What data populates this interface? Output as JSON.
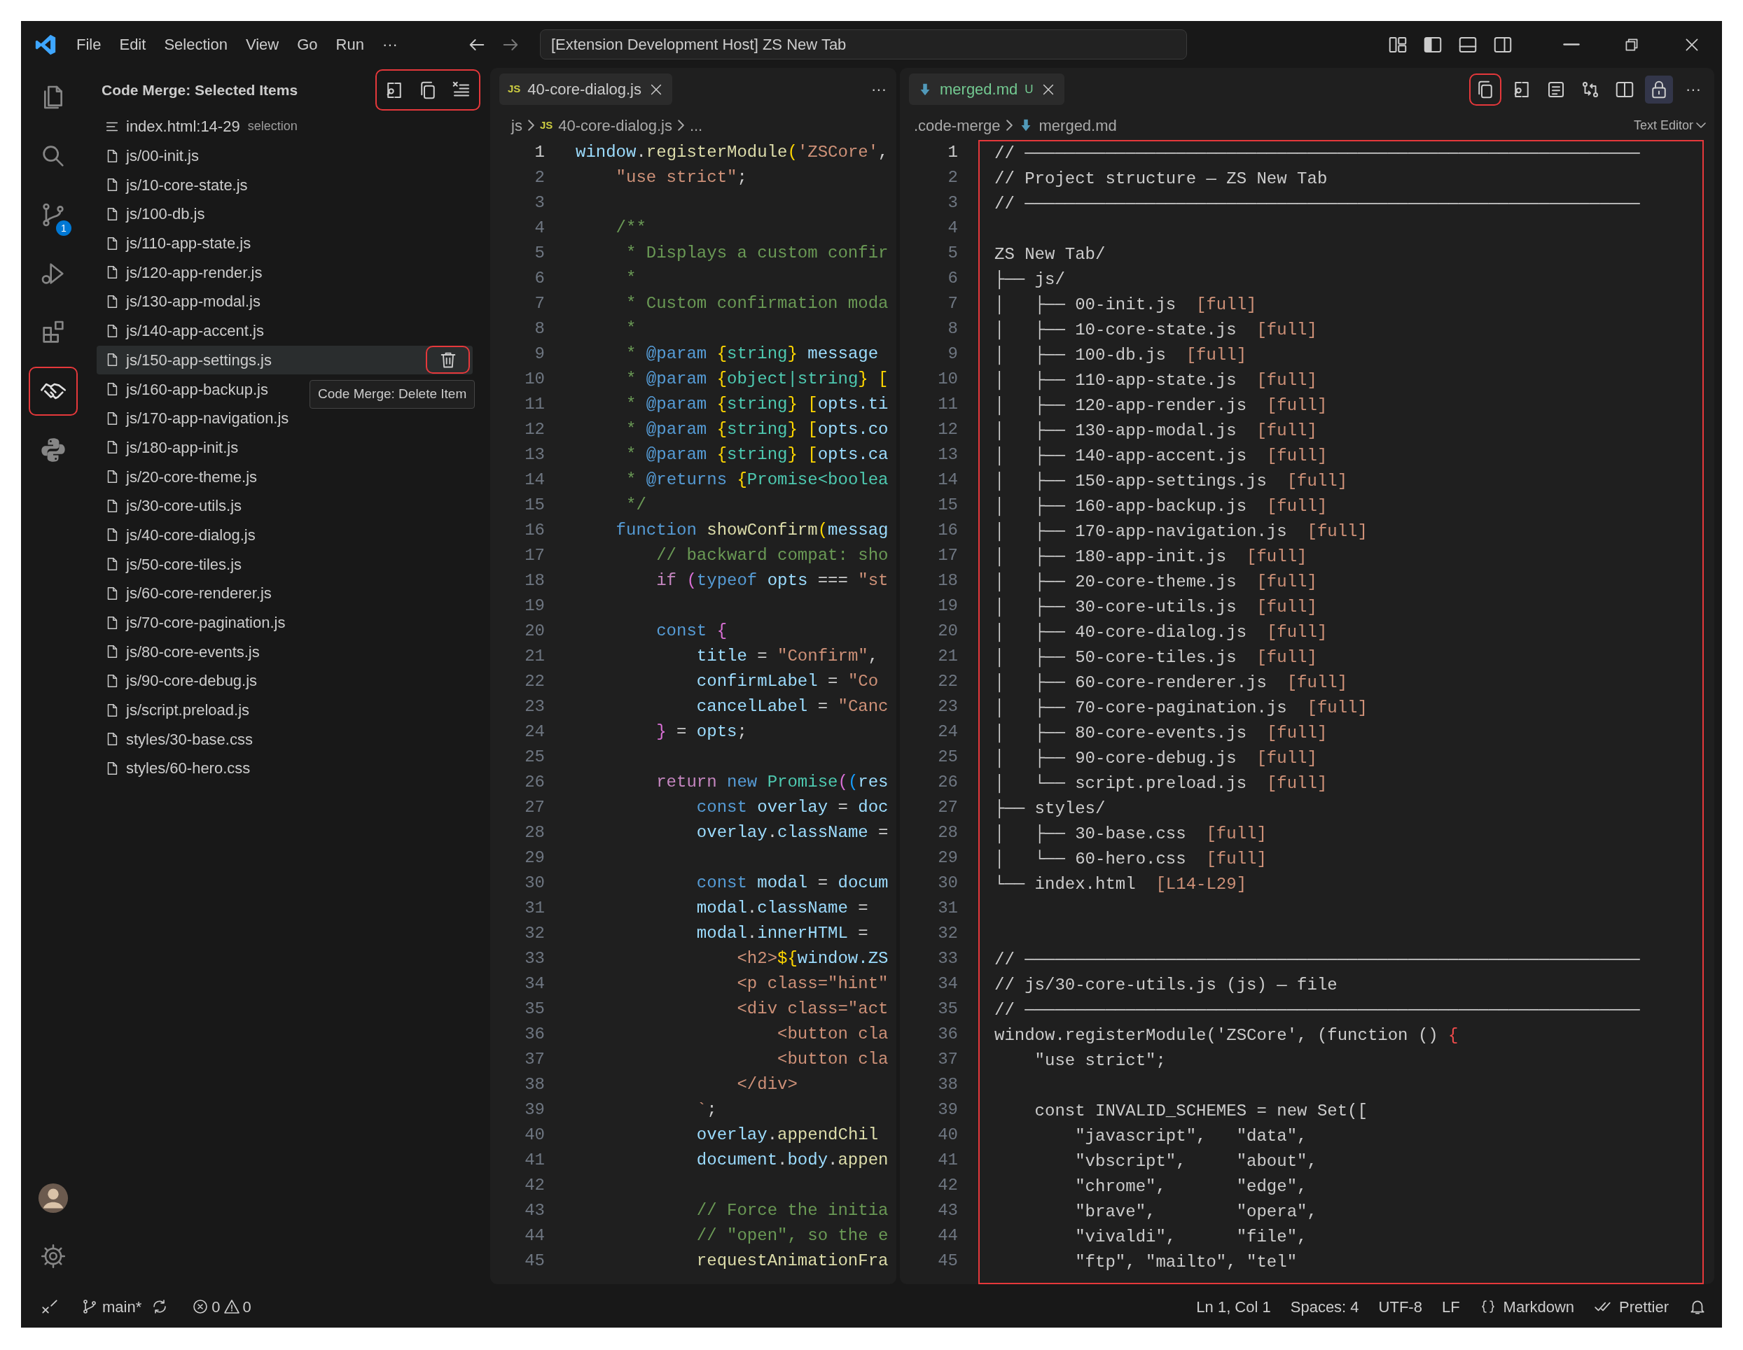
{
  "title_bar": {
    "menus": [
      "File",
      "Edit",
      "Selection",
      "View",
      "Go",
      "Run",
      "···"
    ],
    "command_center": "[Extension Development Host] ZS New Tab"
  },
  "activity_bar": {
    "items": [
      {
        "kind": "explorer",
        "selected": false
      },
      {
        "kind": "search",
        "selected": false
      },
      {
        "kind": "scm",
        "selected": false,
        "badge": "1"
      },
      {
        "kind": "debug",
        "selected": false
      },
      {
        "kind": "extensions",
        "selected": false
      },
      {
        "kind": "handshake",
        "selected": true,
        "red_frame": true
      },
      {
        "kind": "python",
        "selected": false
      }
    ]
  },
  "sidebar": {
    "title": "Code Merge: Selected Items",
    "toolbar_red_frame": true,
    "toolbar": [
      {
        "kind": "compare"
      },
      {
        "kind": "copy"
      },
      {
        "kind": "clear"
      }
    ],
    "items": [
      {
        "kind": "selection",
        "label": "index.html:14-29",
        "description": "selection",
        "hovered": false
      },
      {
        "kind": "file",
        "label": "js/00-init.js",
        "hovered": false
      },
      {
        "kind": "file",
        "label": "js/10-core-state.js",
        "hovered": false
      },
      {
        "kind": "file",
        "label": "js/100-db.js",
        "hovered": false
      },
      {
        "kind": "file",
        "label": "js/110-app-state.js",
        "hovered": false
      },
      {
        "kind": "file",
        "label": "js/120-app-render.js",
        "hovered": false
      },
      {
        "kind": "file",
        "label": "js/130-app-modal.js",
        "hovered": false
      },
      {
        "kind": "file",
        "label": "js/140-app-accent.js",
        "hovered": false
      },
      {
        "kind": "file",
        "label": "js/150-app-settings.js",
        "hovered": true
      },
      {
        "kind": "file",
        "label": "js/160-app-backup.js",
        "hovered": false
      },
      {
        "kind": "file",
        "label": "js/170-app-navigation.js",
        "hovered": false
      },
      {
        "kind": "file",
        "label": "js/180-app-init.js",
        "hovered": false
      },
      {
        "kind": "file",
        "label": "js/20-core-theme.js",
        "hovered": false
      },
      {
        "kind": "file",
        "label": "js/30-core-utils.js",
        "hovered": false
      },
      {
        "kind": "file",
        "label": "js/40-core-dialog.js",
        "hovered": false
      },
      {
        "kind": "file",
        "label": "js/50-core-tiles.js",
        "hovered": false
      },
      {
        "kind": "file",
        "label": "js/60-core-renderer.js",
        "hovered": false
      },
      {
        "kind": "file",
        "label": "js/70-core-pagination.js",
        "hovered": false
      },
      {
        "kind": "file",
        "label": "js/80-core-events.js",
        "hovered": false
      },
      {
        "kind": "file",
        "label": "js/90-core-debug.js",
        "hovered": false
      },
      {
        "kind": "file",
        "label": "js/script.preload.js",
        "hovered": false
      },
      {
        "kind": "file",
        "label": "styles/30-base.css",
        "hovered": false
      },
      {
        "kind": "file",
        "label": "styles/60-hero.css",
        "hovered": false
      }
    ],
    "hover_action": {
      "red_frame": true
    },
    "tooltip": "Code Merge: Delete Item"
  },
  "editors": [
    {
      "tabs": [
        {
          "badge": "JS",
          "label": "40-core-dialog.js",
          "selected": true
        }
      ],
      "more": "···",
      "breadcrumb": [
        {
          "label": "js"
        },
        {
          "label": "40-core-dialog.js",
          "badge": "JS"
        },
        {
          "label": "..."
        }
      ],
      "lines": [
        {
          "n": "1",
          "current": true,
          "tokens": [
            {
              "text": "window",
              "kind": "variable"
            },
            {
              "text": ".",
              "kind": "plain"
            },
            {
              "text": "registerModule",
              "kind": "function"
            },
            {
              "text": "(",
              "kind": "bracket1"
            },
            {
              "text": "'ZSCore'",
              "kind": "string"
            },
            {
              "text": ",",
              "kind": "plain"
            }
          ]
        },
        {
          "n": "2",
          "current": false,
          "tokens": [
            {
              "text": "    \"use strict\"",
              "kind": "string"
            },
            {
              "text": ";",
              "kind": "plain"
            }
          ]
        },
        {
          "n": "3",
          "current": false
        },
        {
          "n": "4",
          "current": false,
          "tokens": [
            {
              "text": "    /**",
              "kind": "comment"
            }
          ]
        },
        {
          "n": "5",
          "current": false,
          "tokens": [
            {
              "text": "     * Displays a custom confir",
              "kind": "comment"
            }
          ]
        },
        {
          "n": "6",
          "current": false,
          "tokens": [
            {
              "text": "     *",
              "kind": "comment"
            }
          ]
        },
        {
          "n": "7",
          "current": false,
          "tokens": [
            {
              "text": "     * Custom confirmation moda",
              "kind": "comment"
            }
          ]
        },
        {
          "n": "8",
          "current": false,
          "tokens": [
            {
              "text": "     *",
              "kind": "comment"
            }
          ]
        },
        {
          "n": "9",
          "current": false,
          "tokens": [
            {
              "text": "     *",
              "kind": "comment"
            },
            {
              "text": " @param ",
              "kind": "keyword"
            },
            {
              "text": "{",
              "kind": "bracket1"
            },
            {
              "text": "string",
              "kind": "type"
            },
            {
              "text": "}",
              "kind": "bracket1"
            },
            {
              "text": " message",
              "kind": "variable"
            }
          ]
        },
        {
          "n": "10",
          "current": false,
          "tokens": [
            {
              "text": "     *",
              "kind": "comment"
            },
            {
              "text": " @param ",
              "kind": "keyword"
            },
            {
              "text": "{",
              "kind": "bracket1"
            },
            {
              "text": "object|string",
              "kind": "type"
            },
            {
              "text": "}",
              "kind": "bracket1"
            },
            {
              "text": " [",
              "kind": "bracket1"
            }
          ]
        },
        {
          "n": "11",
          "current": false,
          "tokens": [
            {
              "text": "     *",
              "kind": "comment"
            },
            {
              "text": " @param ",
              "kind": "keyword"
            },
            {
              "text": "{",
              "kind": "bracket1"
            },
            {
              "text": "string",
              "kind": "type"
            },
            {
              "text": "}",
              "kind": "bracket1"
            },
            {
              "text": " [",
              "kind": "bracket1"
            },
            {
              "text": "opts.ti",
              "kind": "variable"
            }
          ]
        },
        {
          "n": "12",
          "current": false,
          "tokens": [
            {
              "text": "     *",
              "kind": "comment"
            },
            {
              "text": " @param ",
              "kind": "keyword"
            },
            {
              "text": "{",
              "kind": "bracket1"
            },
            {
              "text": "string",
              "kind": "type"
            },
            {
              "text": "}",
              "kind": "bracket1"
            },
            {
              "text": " [",
              "kind": "bracket1"
            },
            {
              "text": "opts.co",
              "kind": "variable"
            }
          ]
        },
        {
          "n": "13",
          "current": false,
          "tokens": [
            {
              "text": "     *",
              "kind": "comment"
            },
            {
              "text": " @param ",
              "kind": "keyword"
            },
            {
              "text": "{",
              "kind": "bracket1"
            },
            {
              "text": "string",
              "kind": "type"
            },
            {
              "text": "}",
              "kind": "bracket1"
            },
            {
              "text": " [",
              "kind": "bracket1"
            },
            {
              "text": "opts.ca",
              "kind": "variable"
            }
          ]
        },
        {
          "n": "14",
          "current": false,
          "tokens": [
            {
              "text": "     *",
              "kind": "comment"
            },
            {
              "text": " @returns ",
              "kind": "keyword"
            },
            {
              "text": "{",
              "kind": "bracket1"
            },
            {
              "text": "Promise<boolea",
              "kind": "type"
            }
          ]
        },
        {
          "n": "15",
          "current": false,
          "tokens": [
            {
              "text": "     */",
              "kind": "comment"
            }
          ]
        },
        {
          "n": "16",
          "current": false,
          "tokens": [
            {
              "text": "    function ",
              "kind": "keyword"
            },
            {
              "text": "showConfirm",
              "kind": "function"
            },
            {
              "text": "(",
              "kind": "bracket1"
            },
            {
              "text": "messag",
              "kind": "variable"
            }
          ]
        },
        {
          "n": "17",
          "current": false,
          "tokens": [
            {
              "text": "        // backward compat: sho",
              "kind": "comment"
            }
          ]
        },
        {
          "n": "18",
          "current": false,
          "tokens": [
            {
              "text": "        if ",
              "kind": "control"
            },
            {
              "text": "(",
              "kind": "bracket2"
            },
            {
              "text": "typeof",
              "kind": "keyword"
            },
            {
              "text": " opts",
              "kind": "variable"
            },
            {
              "text": " === ",
              "kind": "plain"
            },
            {
              "text": "\"st",
              "kind": "string"
            }
          ]
        },
        {
          "n": "19",
          "current": false
        },
        {
          "n": "20",
          "current": false,
          "tokens": [
            {
              "text": "        const ",
              "kind": "keyword"
            },
            {
              "text": "{",
              "kind": "bracket2"
            }
          ]
        },
        {
          "n": "21",
          "current": false,
          "tokens": [
            {
              "text": "            title",
              "kind": "variable"
            },
            {
              "text": " = ",
              "kind": "plain"
            },
            {
              "text": "\"Confirm\"",
              "kind": "string"
            },
            {
              "text": ",",
              "kind": "plain"
            }
          ]
        },
        {
          "n": "22",
          "current": false,
          "tokens": [
            {
              "text": "            confirmLabel",
              "kind": "variable"
            },
            {
              "text": " = ",
              "kind": "plain"
            },
            {
              "text": "\"Co",
              "kind": "string"
            }
          ]
        },
        {
          "n": "23",
          "current": false,
          "tokens": [
            {
              "text": "            cancelLabel",
              "kind": "variable"
            },
            {
              "text": " = ",
              "kind": "plain"
            },
            {
              "text": "\"Canc",
              "kind": "string"
            }
          ]
        },
        {
          "n": "24",
          "current": false,
          "tokens": [
            {
              "text": "        }",
              "kind": "bracket2"
            },
            {
              "text": " = ",
              "kind": "plain"
            },
            {
              "text": "opts",
              "kind": "variable"
            },
            {
              "text": ";",
              "kind": "plain"
            }
          ]
        },
        {
          "n": "25",
          "current": false
        },
        {
          "n": "26",
          "current": false,
          "tokens": [
            {
              "text": "        return",
              "kind": "control"
            },
            {
              "text": " new",
              "kind": "keyword"
            },
            {
              "text": " Promise",
              "kind": "type"
            },
            {
              "text": "(",
              "kind": "bracket2"
            },
            {
              "text": "(",
              "kind": "bracket3"
            },
            {
              "text": "res",
              "kind": "variable"
            }
          ]
        },
        {
          "n": "27",
          "current": false,
          "tokens": [
            {
              "text": "            const",
              "kind": "keyword"
            },
            {
              "text": " overlay",
              "kind": "variable"
            },
            {
              "text": " = ",
              "kind": "plain"
            },
            {
              "text": "doc",
              "kind": "variable"
            }
          ]
        },
        {
          "n": "28",
          "current": false,
          "tokens": [
            {
              "text": "            overlay",
              "kind": "variable"
            },
            {
              "text": ".",
              "kind": "plain"
            },
            {
              "text": "className",
              "kind": "variable"
            },
            {
              "text": " =",
              "kind": "plain"
            }
          ]
        },
        {
          "n": "29",
          "current": false
        },
        {
          "n": "30",
          "current": false,
          "tokens": [
            {
              "text": "            const",
              "kind": "keyword"
            },
            {
              "text": " modal",
              "kind": "variable"
            },
            {
              "text": " = ",
              "kind": "plain"
            },
            {
              "text": "docum",
              "kind": "variable"
            }
          ]
        },
        {
          "n": "31",
          "current": false,
          "tokens": [
            {
              "text": "            modal",
              "kind": "variable"
            },
            {
              "text": ".",
              "kind": "plain"
            },
            {
              "text": "className",
              "kind": "variable"
            },
            {
              "text": " =",
              "kind": "plain"
            }
          ]
        },
        {
          "n": "32",
          "current": false,
          "tokens": [
            {
              "text": "            modal",
              "kind": "variable"
            },
            {
              "text": ".",
              "kind": "plain"
            },
            {
              "text": "innerHTML",
              "kind": "variable"
            },
            {
              "text": " =",
              "kind": "plain"
            }
          ]
        },
        {
          "n": "33",
          "current": false,
          "tokens": [
            {
              "text": "                <h2>",
              "kind": "string"
            },
            {
              "text": "${",
              "kind": "bracket1"
            },
            {
              "text": "window.ZS",
              "kind": "variable"
            }
          ]
        },
        {
          "n": "34",
          "current": false,
          "tokens": [
            {
              "text": "                <p class=\"hint\"",
              "kind": "string"
            }
          ]
        },
        {
          "n": "35",
          "current": false,
          "tokens": [
            {
              "text": "                <div class=\"act",
              "kind": "string"
            }
          ]
        },
        {
          "n": "36",
          "current": false,
          "tokens": [
            {
              "text": "                    <button cla",
              "kind": "string"
            }
          ]
        },
        {
          "n": "37",
          "current": false,
          "tokens": [
            {
              "text": "                    <button cla",
              "kind": "string"
            }
          ]
        },
        {
          "n": "38",
          "current": false,
          "tokens": [
            {
              "text": "                </div>",
              "kind": "string"
            }
          ]
        },
        {
          "n": "39",
          "current": false,
          "tokens": [
            {
              "text": "            `",
              "kind": "string"
            },
            {
              "text": ";",
              "kind": "plain"
            }
          ]
        },
        {
          "n": "40",
          "current": false,
          "tokens": [
            {
              "text": "            overlay",
              "kind": "variable"
            },
            {
              "text": ".",
              "kind": "plain"
            },
            {
              "text": "appendChil",
              "kind": "function"
            }
          ]
        },
        {
          "n": "41",
          "current": false,
          "tokens": [
            {
              "text": "            document",
              "kind": "variable"
            },
            {
              "text": ".",
              "kind": "plain"
            },
            {
              "text": "body",
              "kind": "variable"
            },
            {
              "text": ".",
              "kind": "plain"
            },
            {
              "text": "appen",
              "kind": "function"
            }
          ]
        },
        {
          "n": "42",
          "current": false
        },
        {
          "n": "43",
          "current": false,
          "tokens": [
            {
              "text": "            // Force the initia",
              "kind": "comment"
            }
          ]
        },
        {
          "n": "44",
          "current": false,
          "tokens": [
            {
              "text": "            // \"open\", so the e",
              "kind": "comment"
            }
          ]
        },
        {
          "n": "45",
          "current": false,
          "tokens": [
            {
              "text": "            requestAnimationFra",
              "kind": "function"
            }
          ]
        }
      ]
    },
    {
      "tabs": [
        {
          "kind": "markdown",
          "label": "merged.md",
          "status": "U",
          "selected": true
        }
      ],
      "toolbar": [
        {
          "kind": "copy",
          "red_frame": true
        },
        {
          "kind": "compare"
        },
        {
          "kind": "preview"
        },
        {
          "kind": "gitcompare"
        },
        {
          "kind": "split"
        },
        {
          "kind": "lock",
          "on": true
        },
        {
          "kind": "more",
          "text": "···"
        }
      ],
      "breadcrumb": [
        {
          "label": ".code-merge"
        },
        {
          "label": "merged.md",
          "kind": "markdown"
        }
      ],
      "view_mode": "Text Editor",
      "red_frame": true,
      "lines": [
        {
          "n": "1",
          "current": true,
          "tokens": [
            {
              "text": "// ─────────────────────────────────────────────────────────────",
              "kind": "plain"
            }
          ]
        },
        {
          "n": "2",
          "current": false,
          "tokens": [
            {
              "text": "// Project structure — ZS New Tab",
              "kind": "plain"
            }
          ]
        },
        {
          "n": "3",
          "current": false,
          "tokens": [
            {
              "text": "// ─────────────────────────────────────────────────────────────",
              "kind": "plain"
            }
          ]
        },
        {
          "n": "4",
          "current": false
        },
        {
          "n": "5",
          "current": false,
          "tokens": [
            {
              "text": "ZS New Tab/",
              "kind": "plain"
            }
          ]
        },
        {
          "n": "6",
          "current": false,
          "tokens": [
            {
              "text": "├── js/",
              "kind": "plain"
            }
          ]
        },
        {
          "n": "7",
          "current": false,
          "tokens": [
            {
              "text": "│   ├── 00-init.js  ",
              "kind": "plain"
            },
            {
              "text": "[full]",
              "kind": "tag"
            }
          ]
        },
        {
          "n": "8",
          "current": false,
          "tokens": [
            {
              "text": "│   ├── 10-core-state.js  ",
              "kind": "plain"
            },
            {
              "text": "[full]",
              "kind": "tag"
            }
          ]
        },
        {
          "n": "9",
          "current": false,
          "tokens": [
            {
              "text": "│   ├── 100-db.js  ",
              "kind": "plain"
            },
            {
              "text": "[full]",
              "kind": "tag"
            }
          ]
        },
        {
          "n": "10",
          "current": false,
          "tokens": [
            {
              "text": "│   ├── 110-app-state.js  ",
              "kind": "plain"
            },
            {
              "text": "[full]",
              "kind": "tag"
            }
          ]
        },
        {
          "n": "11",
          "current": false,
          "tokens": [
            {
              "text": "│   ├── 120-app-render.js  ",
              "kind": "plain"
            },
            {
              "text": "[full]",
              "kind": "tag"
            }
          ]
        },
        {
          "n": "12",
          "current": false,
          "tokens": [
            {
              "text": "│   ├── 130-app-modal.js  ",
              "kind": "plain"
            },
            {
              "text": "[full]",
              "kind": "tag"
            }
          ]
        },
        {
          "n": "13",
          "current": false,
          "tokens": [
            {
              "text": "│   ├── 140-app-accent.js  ",
              "kind": "plain"
            },
            {
              "text": "[full]",
              "kind": "tag"
            }
          ]
        },
        {
          "n": "14",
          "current": false,
          "tokens": [
            {
              "text": "│   ├── 150-app-settings.js  ",
              "kind": "plain"
            },
            {
              "text": "[full]",
              "kind": "tag"
            }
          ]
        },
        {
          "n": "15",
          "current": false,
          "tokens": [
            {
              "text": "│   ├── 160-app-backup.js  ",
              "kind": "plain"
            },
            {
              "text": "[full]",
              "kind": "tag"
            }
          ]
        },
        {
          "n": "16",
          "current": false,
          "tokens": [
            {
              "text": "│   ├── 170-app-navigation.js  ",
              "kind": "plain"
            },
            {
              "text": "[full]",
              "kind": "tag"
            }
          ]
        },
        {
          "n": "17",
          "current": false,
          "tokens": [
            {
              "text": "│   ├── 180-app-init.js  ",
              "kind": "plain"
            },
            {
              "text": "[full]",
              "kind": "tag"
            }
          ]
        },
        {
          "n": "18",
          "current": false,
          "tokens": [
            {
              "text": "│   ├── 20-core-theme.js  ",
              "kind": "plain"
            },
            {
              "text": "[full]",
              "kind": "tag"
            }
          ]
        },
        {
          "n": "19",
          "current": false,
          "tokens": [
            {
              "text": "│   ├── 30-core-utils.js  ",
              "kind": "plain"
            },
            {
              "text": "[full]",
              "kind": "tag"
            }
          ]
        },
        {
          "n": "20",
          "current": false,
          "tokens": [
            {
              "text": "│   ├── 40-core-dialog.js  ",
              "kind": "plain"
            },
            {
              "text": "[full]",
              "kind": "tag"
            }
          ]
        },
        {
          "n": "21",
          "current": false,
          "tokens": [
            {
              "text": "│   ├── 50-core-tiles.js  ",
              "kind": "plain"
            },
            {
              "text": "[full]",
              "kind": "tag"
            }
          ]
        },
        {
          "n": "22",
          "current": false,
          "tokens": [
            {
              "text": "│   ├── 60-core-renderer.js  ",
              "kind": "plain"
            },
            {
              "text": "[full]",
              "kind": "tag"
            }
          ]
        },
        {
          "n": "23",
          "current": false,
          "tokens": [
            {
              "text": "│   ├── 70-core-pagination.js  ",
              "kind": "plain"
            },
            {
              "text": "[full]",
              "kind": "tag"
            }
          ]
        },
        {
          "n": "24",
          "current": false,
          "tokens": [
            {
              "text": "│   ├── 80-core-events.js  ",
              "kind": "plain"
            },
            {
              "text": "[full]",
              "kind": "tag"
            }
          ]
        },
        {
          "n": "25",
          "current": false,
          "tokens": [
            {
              "text": "│   ├── 90-core-debug.js  ",
              "kind": "plain"
            },
            {
              "text": "[full]",
              "kind": "tag"
            }
          ]
        },
        {
          "n": "26",
          "current": false,
          "tokens": [
            {
              "text": "│   └── script.preload.js  ",
              "kind": "plain"
            },
            {
              "text": "[full]",
              "kind": "tag"
            }
          ]
        },
        {
          "n": "27",
          "current": false,
          "tokens": [
            {
              "text": "├── styles/",
              "kind": "plain"
            }
          ]
        },
        {
          "n": "28",
          "current": false,
          "tokens": [
            {
              "text": "│   ├── 30-base.css  ",
              "kind": "plain"
            },
            {
              "text": "[full]",
              "kind": "tag"
            }
          ]
        },
        {
          "n": "29",
          "current": false,
          "tokens": [
            {
              "text": "│   └── 60-hero.css  ",
              "kind": "plain"
            },
            {
              "text": "[full]",
              "kind": "tag"
            }
          ]
        },
        {
          "n": "30",
          "current": false,
          "tokens": [
            {
              "text": "└── index.html  ",
              "kind": "plain"
            },
            {
              "text": "[L14-L29]",
              "kind": "tag"
            }
          ]
        },
        {
          "n": "31",
          "current": false
        },
        {
          "n": "32",
          "current": false
        },
        {
          "n": "33",
          "current": false,
          "tokens": [
            {
              "text": "// ─────────────────────────────────────────────────────────────",
              "kind": "plain"
            }
          ]
        },
        {
          "n": "34",
          "current": false,
          "tokens": [
            {
              "text": "// js/30-core-utils.js (js) — file",
              "kind": "plain"
            }
          ]
        },
        {
          "n": "35",
          "current": false,
          "tokens": [
            {
              "text": "// ─────────────────────────────────────────────────────────────",
              "kind": "plain"
            }
          ]
        },
        {
          "n": "36",
          "current": false,
          "tokens": [
            {
              "text": "window.registerModule('ZSCore', (function () ",
              "kind": "plain"
            },
            {
              "text": "{",
              "kind": "error"
            }
          ]
        },
        {
          "n": "37",
          "current": false,
          "tokens": [
            {
              "text": "    \"use strict\";",
              "kind": "plain"
            }
          ]
        },
        {
          "n": "38",
          "current": false
        },
        {
          "n": "39",
          "current": false,
          "tokens": [
            {
              "text": "    const INVALID_SCHEMES = new Set([",
              "kind": "plain"
            }
          ]
        },
        {
          "n": "40",
          "current": false,
          "tokens": [
            {
              "text": "        \"javascript\",   \"data\",",
              "kind": "plain"
            }
          ]
        },
        {
          "n": "41",
          "current": false,
          "tokens": [
            {
              "text": "        \"vbscript\",     \"about\",",
              "kind": "plain"
            }
          ]
        },
        {
          "n": "42",
          "current": false,
          "tokens": [
            {
              "text": "        \"chrome\",       \"edge\",",
              "kind": "plain"
            }
          ]
        },
        {
          "n": "43",
          "current": false,
          "tokens": [
            {
              "text": "        \"brave\",        \"opera\",",
              "kind": "plain"
            }
          ]
        },
        {
          "n": "44",
          "current": false,
          "tokens": [
            {
              "text": "        \"vivaldi\",      \"file\",",
              "kind": "plain"
            }
          ]
        },
        {
          "n": "45",
          "current": false,
          "tokens": [
            {
              "text": "        \"ftp\", \"mailto\", \"tel\"",
              "kind": "plain"
            }
          ]
        }
      ]
    }
  ],
  "status_bar": {
    "branch": "main*",
    "errors": "0",
    "warnings": "0",
    "items": [
      {
        "text": "Ln 1, Col 1"
      },
      {
        "text": "Spaces: 4"
      },
      {
        "text": "UTF-8"
      },
      {
        "text": "LF"
      },
      {
        "text": "Markdown",
        "kind": "language"
      },
      {
        "text": "Prettier",
        "kind": "formatter"
      }
    ]
  }
}
